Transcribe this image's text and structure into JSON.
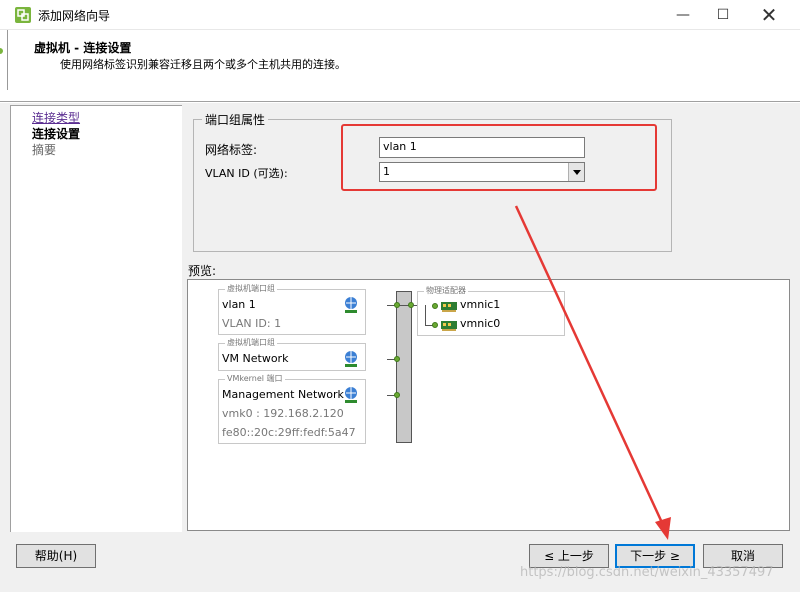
{
  "window": {
    "title": "添加网络向导",
    "min_glyph": "—",
    "max_glyph": "☐",
    "close_glyph": "✕"
  },
  "header": {
    "title": "虚拟机 - 连接设置",
    "description": "使用网络标签识别兼容迁移且两个或多个主机共用的连接。"
  },
  "nav": {
    "items": [
      {
        "label": "连接类型",
        "state": "visited"
      },
      {
        "label": "连接设置",
        "state": "current"
      },
      {
        "label": "摘要",
        "state": "upcoming"
      }
    ]
  },
  "port_group": {
    "group_title": "端口组属性",
    "network_label_caption": "网络标签:",
    "network_label_value": "vlan 1",
    "vlan_id_caption": "VLAN ID (可选):",
    "vlan_id_value": "1"
  },
  "preview": {
    "label": "预览:",
    "port_groups": [
      {
        "title": "虚拟机端口组",
        "name": "vlan 1",
        "details": [
          "VLAN ID: 1"
        ]
      },
      {
        "title": "虚拟机端口组",
        "name": "VM Network",
        "details": []
      },
      {
        "title": "VMkernel 端口",
        "name": "Management Network",
        "details": [
          "vmk0 : 192.168.2.120",
          "fe80::20c:29ff:fedf:5a47"
        ]
      }
    ],
    "adapters_title": "物理适配器",
    "adapters": [
      "vmnic1",
      "vmnic0"
    ]
  },
  "buttons": {
    "help": "帮助(H)",
    "back": "≤ 上一步",
    "next": "下一步 ≥",
    "cancel": "取消"
  },
  "watermark": "https://blog.csdn.net/weixin_43357497",
  "colors": {
    "annotation": "#e53935",
    "accent": "#0078d7",
    "visited_link": "#5a2d91"
  }
}
